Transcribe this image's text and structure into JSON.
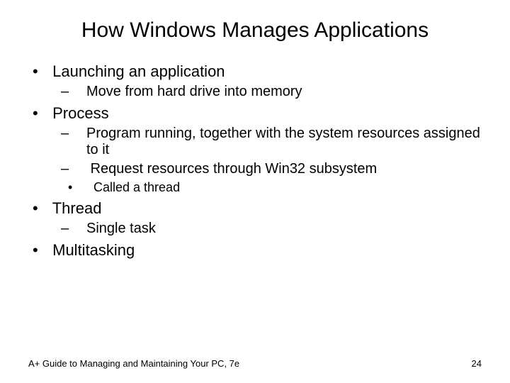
{
  "title": "How Windows Manages Applications",
  "bullets": {
    "b0": "Launching an application",
    "b0_s0": "Move from hard drive into memory",
    "b1": "Process",
    "b1_s0": "Program running, together with the system resources assigned to it",
    "b1_s1": "Request resources through Win32 subsystem",
    "b1_s1_t0": "Called a thread",
    "b2": "Thread",
    "b2_s0": "Single task",
    "b3": "Multitasking"
  },
  "footer": {
    "source": "A+ Guide to Managing and Maintaining Your PC, 7e",
    "page": "24"
  }
}
